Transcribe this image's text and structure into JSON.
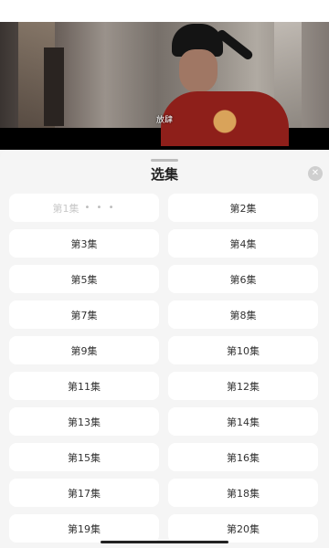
{
  "video": {
    "subtitle": "放肆"
  },
  "sheet": {
    "title": "选集",
    "close_icon": "close-icon"
  },
  "episodes": [
    {
      "label": "第1集",
      "state": "current-loading"
    },
    {
      "label": "第2集"
    },
    {
      "label": "第3集"
    },
    {
      "label": "第4集"
    },
    {
      "label": "第5集"
    },
    {
      "label": "第6集"
    },
    {
      "label": "第7集"
    },
    {
      "label": "第8集"
    },
    {
      "label": "第9集"
    },
    {
      "label": "第10集"
    },
    {
      "label": "第11集"
    },
    {
      "label": "第12集"
    },
    {
      "label": "第13集"
    },
    {
      "label": "第14集"
    },
    {
      "label": "第15集"
    },
    {
      "label": "第16集"
    },
    {
      "label": "第17集"
    },
    {
      "label": "第18集"
    },
    {
      "label": "第19集"
    },
    {
      "label": "第20集"
    }
  ]
}
